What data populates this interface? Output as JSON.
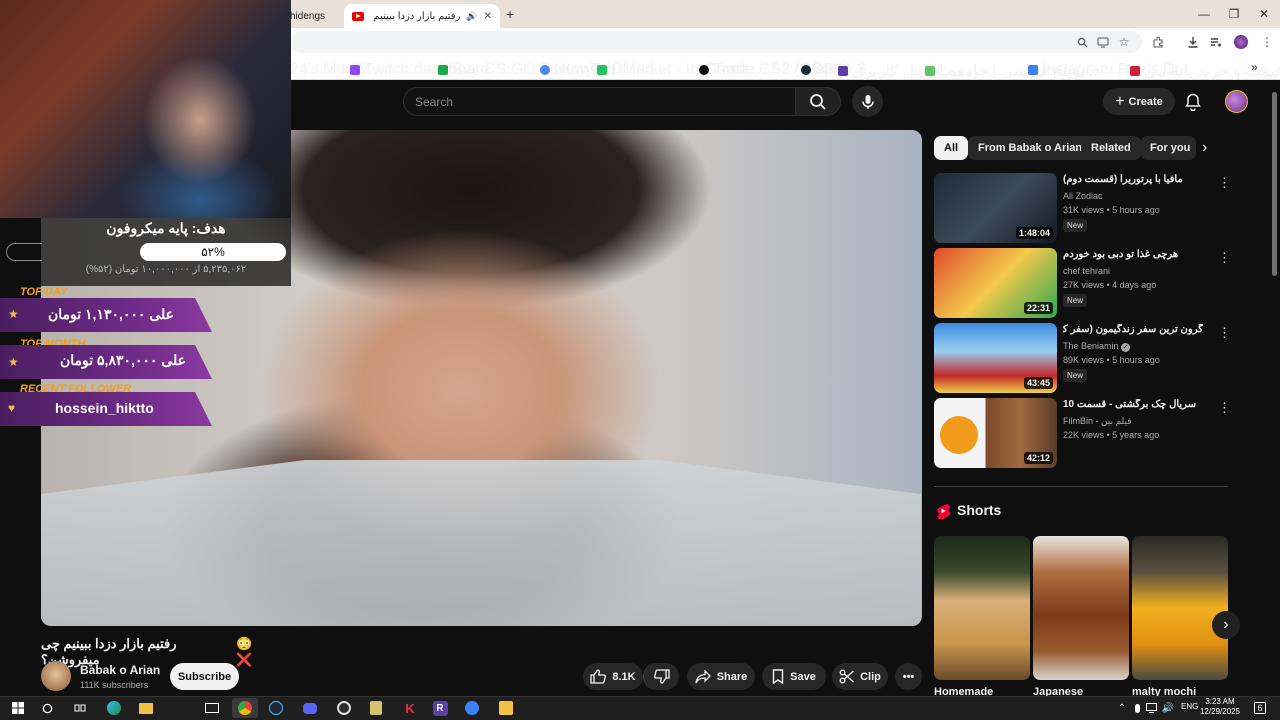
{
  "browser": {
    "tabs": [
      {
        "label": "hidengs"
      },
      {
        "label": "رفتیم بازار دزدا ببینیم چی میفـ",
        "active": true
      }
    ],
    "new_tab_label": "+",
    "window_controls": [
      "—",
      "❐",
      "✕"
    ],
    "bookmarks": [
      {
        "label": "24's Mod V...",
        "color": "#555"
      },
      {
        "label": "Twitch dashboard",
        "color": "#9146ff"
      },
      {
        "label": "Buy CS:GO Factory...",
        "color": "#1aa84a"
      },
      {
        "label": "New Tab",
        "color": "#4a8af4"
      },
      {
        "label": "DMarket - In-Game...",
        "color": "#22c55e"
      },
      {
        "label": "Trade CS2 (CSGO) S...",
        "color": "#111"
      },
      {
        "label": "api",
        "color": "#1b2838"
      },
      {
        "label": "ریمیت | پنل کاربری",
        "color": "#5b3fa8"
      },
      {
        "label": "توییچ فارسی | جامعه ا...",
        "color": "#62c462"
      },
      {
        "label": "Instagram Reels Do...",
        "color": "#3b82f6"
      },
      {
        "label": "قیمت و خرید پایه می...",
        "color": "#d01e3c"
      }
    ],
    "bookmarks_more": "»"
  },
  "header": {
    "search_placeholder": "Search",
    "create_label": "Create"
  },
  "overlay": {
    "goal_title": "هدف: پایه میکروفون",
    "goal_percent": "۵۲%",
    "goal_progress": 0.52,
    "goal_sub": "۵,۲۳۵,۰۶۲ از ۱۰,۰۰۰,۰۰۰ تومان (۵۲%)",
    "top_day_label": "TOP DAY",
    "top_day_value": "علی ۱,۱۳۰,۰۰۰ تومان",
    "top_month_label": "TOP MONTH",
    "top_month_value": "علی ۵,۸۳۰,۰۰۰ تومان",
    "recent_follower_label": "RECENT FOLLOWER",
    "recent_follower_value": "hossein_hiktto"
  },
  "video": {
    "title": "رفتیم بازار دزدا ببینیم چی میفروشن؟",
    "title_emojis": "😳 ❌",
    "channel": "Babak o Arian",
    "subscribers": "111K subscribers",
    "subscribe_label": "Subscribe",
    "likes": "8.1K",
    "share_label": "Share",
    "save_label": "Save",
    "clip_label": "Clip"
  },
  "chips": [
    "All",
    "From Babak o Arian",
    "Related",
    "For you"
  ],
  "recommendations": [
    {
      "title": "مافیا با پرتوریرا (قسمت دوم)",
      "channel": "Ali Zodiac",
      "meta": "31K views • 5 hours ago",
      "duration": "1:48:04",
      "badge": "New",
      "thumb": "#2b3440"
    },
    {
      "title": "هرچی غذا تو دبی بود خوردم",
      "channel": "chef tehrani",
      "meta": "27K views • 4 days ago",
      "duration": "22:31",
      "badge": "New",
      "thumb": "#c8302a"
    },
    {
      "title": "گرون ترین سفر زندگیمون (سفر کیش) 💵",
      "channel": "The Beniamin",
      "meta": "89K views • 5 hours ago",
      "duration": "43:45",
      "badge": "New",
      "thumb": "#2a6fc8",
      "verified": true
    },
    {
      "title": "سریال چک برگشتی - قسمت 10",
      "channel": "FilmBin - فیلم بین",
      "meta": "22K views • 5 years ago",
      "duration": "42:12",
      "badge": "",
      "thumb": "#8a5a3a"
    }
  ],
  "shorts": {
    "title": "Shorts",
    "items": [
      {
        "caption": "Homemade",
        "color": "#5a4a2a"
      },
      {
        "caption": "Japanese",
        "color": "#7a3a1a"
      },
      {
        "caption": "malty mochi",
        "color": "#3a3a2a"
      }
    ]
  },
  "taskbar": {
    "lang": "ENG",
    "time": "3:23 AM",
    "date": "12/29/2025",
    "notifications": "6"
  }
}
